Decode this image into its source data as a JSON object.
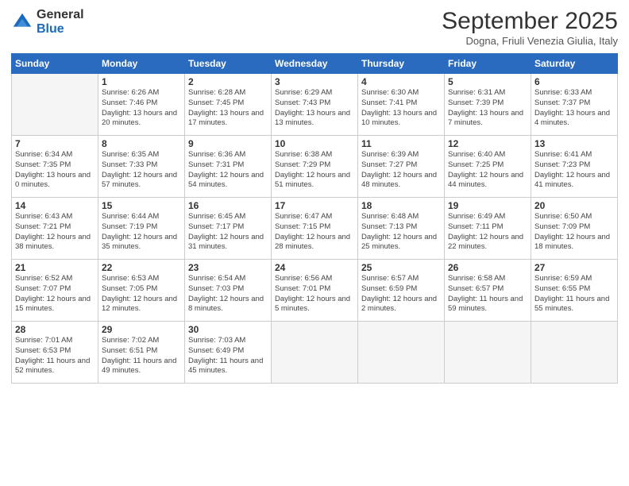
{
  "logo": {
    "general": "General",
    "blue": "Blue"
  },
  "header": {
    "month": "September 2025",
    "location": "Dogna, Friuli Venezia Giulia, Italy"
  },
  "days_of_week": [
    "Sunday",
    "Monday",
    "Tuesday",
    "Wednesday",
    "Thursday",
    "Friday",
    "Saturday"
  ],
  "weeks": [
    [
      {
        "day": "",
        "empty": true
      },
      {
        "day": "1",
        "sunrise": "Sunrise: 6:26 AM",
        "sunset": "Sunset: 7:46 PM",
        "daylight": "Daylight: 13 hours and 20 minutes."
      },
      {
        "day": "2",
        "sunrise": "Sunrise: 6:28 AM",
        "sunset": "Sunset: 7:45 PM",
        "daylight": "Daylight: 13 hours and 17 minutes."
      },
      {
        "day": "3",
        "sunrise": "Sunrise: 6:29 AM",
        "sunset": "Sunset: 7:43 PM",
        "daylight": "Daylight: 13 hours and 13 minutes."
      },
      {
        "day": "4",
        "sunrise": "Sunrise: 6:30 AM",
        "sunset": "Sunset: 7:41 PM",
        "daylight": "Daylight: 13 hours and 10 minutes."
      },
      {
        "day": "5",
        "sunrise": "Sunrise: 6:31 AM",
        "sunset": "Sunset: 7:39 PM",
        "daylight": "Daylight: 13 hours and 7 minutes."
      },
      {
        "day": "6",
        "sunrise": "Sunrise: 6:33 AM",
        "sunset": "Sunset: 7:37 PM",
        "daylight": "Daylight: 13 hours and 4 minutes."
      }
    ],
    [
      {
        "day": "7",
        "sunrise": "Sunrise: 6:34 AM",
        "sunset": "Sunset: 7:35 PM",
        "daylight": "Daylight: 13 hours and 0 minutes."
      },
      {
        "day": "8",
        "sunrise": "Sunrise: 6:35 AM",
        "sunset": "Sunset: 7:33 PM",
        "daylight": "Daylight: 12 hours and 57 minutes."
      },
      {
        "day": "9",
        "sunrise": "Sunrise: 6:36 AM",
        "sunset": "Sunset: 7:31 PM",
        "daylight": "Daylight: 12 hours and 54 minutes."
      },
      {
        "day": "10",
        "sunrise": "Sunrise: 6:38 AM",
        "sunset": "Sunset: 7:29 PM",
        "daylight": "Daylight: 12 hours and 51 minutes."
      },
      {
        "day": "11",
        "sunrise": "Sunrise: 6:39 AM",
        "sunset": "Sunset: 7:27 PM",
        "daylight": "Daylight: 12 hours and 48 minutes."
      },
      {
        "day": "12",
        "sunrise": "Sunrise: 6:40 AM",
        "sunset": "Sunset: 7:25 PM",
        "daylight": "Daylight: 12 hours and 44 minutes."
      },
      {
        "day": "13",
        "sunrise": "Sunrise: 6:41 AM",
        "sunset": "Sunset: 7:23 PM",
        "daylight": "Daylight: 12 hours and 41 minutes."
      }
    ],
    [
      {
        "day": "14",
        "sunrise": "Sunrise: 6:43 AM",
        "sunset": "Sunset: 7:21 PM",
        "daylight": "Daylight: 12 hours and 38 minutes."
      },
      {
        "day": "15",
        "sunrise": "Sunrise: 6:44 AM",
        "sunset": "Sunset: 7:19 PM",
        "daylight": "Daylight: 12 hours and 35 minutes."
      },
      {
        "day": "16",
        "sunrise": "Sunrise: 6:45 AM",
        "sunset": "Sunset: 7:17 PM",
        "daylight": "Daylight: 12 hours and 31 minutes."
      },
      {
        "day": "17",
        "sunrise": "Sunrise: 6:47 AM",
        "sunset": "Sunset: 7:15 PM",
        "daylight": "Daylight: 12 hours and 28 minutes."
      },
      {
        "day": "18",
        "sunrise": "Sunrise: 6:48 AM",
        "sunset": "Sunset: 7:13 PM",
        "daylight": "Daylight: 12 hours and 25 minutes."
      },
      {
        "day": "19",
        "sunrise": "Sunrise: 6:49 AM",
        "sunset": "Sunset: 7:11 PM",
        "daylight": "Daylight: 12 hours and 22 minutes."
      },
      {
        "day": "20",
        "sunrise": "Sunrise: 6:50 AM",
        "sunset": "Sunset: 7:09 PM",
        "daylight": "Daylight: 12 hours and 18 minutes."
      }
    ],
    [
      {
        "day": "21",
        "sunrise": "Sunrise: 6:52 AM",
        "sunset": "Sunset: 7:07 PM",
        "daylight": "Daylight: 12 hours and 15 minutes."
      },
      {
        "day": "22",
        "sunrise": "Sunrise: 6:53 AM",
        "sunset": "Sunset: 7:05 PM",
        "daylight": "Daylight: 12 hours and 12 minutes."
      },
      {
        "day": "23",
        "sunrise": "Sunrise: 6:54 AM",
        "sunset": "Sunset: 7:03 PM",
        "daylight": "Daylight: 12 hours and 8 minutes."
      },
      {
        "day": "24",
        "sunrise": "Sunrise: 6:56 AM",
        "sunset": "Sunset: 7:01 PM",
        "daylight": "Daylight: 12 hours and 5 minutes."
      },
      {
        "day": "25",
        "sunrise": "Sunrise: 6:57 AM",
        "sunset": "Sunset: 6:59 PM",
        "daylight": "Daylight: 12 hours and 2 minutes."
      },
      {
        "day": "26",
        "sunrise": "Sunrise: 6:58 AM",
        "sunset": "Sunset: 6:57 PM",
        "daylight": "Daylight: 11 hours and 59 minutes."
      },
      {
        "day": "27",
        "sunrise": "Sunrise: 6:59 AM",
        "sunset": "Sunset: 6:55 PM",
        "daylight": "Daylight: 11 hours and 55 minutes."
      }
    ],
    [
      {
        "day": "28",
        "sunrise": "Sunrise: 7:01 AM",
        "sunset": "Sunset: 6:53 PM",
        "daylight": "Daylight: 11 hours and 52 minutes."
      },
      {
        "day": "29",
        "sunrise": "Sunrise: 7:02 AM",
        "sunset": "Sunset: 6:51 PM",
        "daylight": "Daylight: 11 hours and 49 minutes."
      },
      {
        "day": "30",
        "sunrise": "Sunrise: 7:03 AM",
        "sunset": "Sunset: 6:49 PM",
        "daylight": "Daylight: 11 hours and 45 minutes."
      },
      {
        "day": "",
        "empty": true
      },
      {
        "day": "",
        "empty": true
      },
      {
        "day": "",
        "empty": true
      },
      {
        "day": "",
        "empty": true
      }
    ]
  ]
}
